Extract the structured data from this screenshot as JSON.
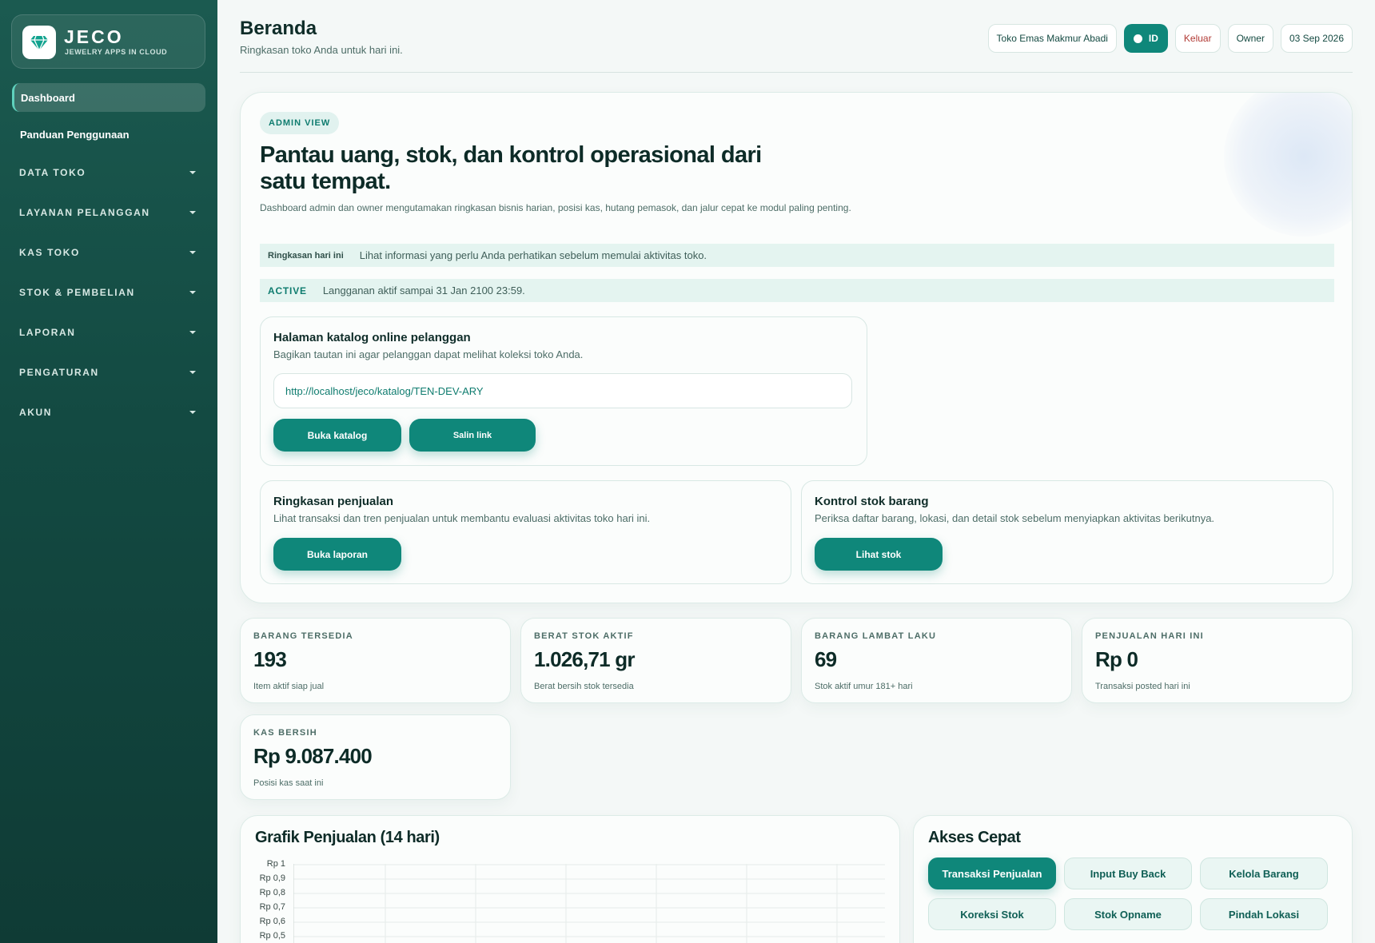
{
  "brand": {
    "name": "JECO",
    "tagline": "JEWELRY APPS IN CLOUD"
  },
  "sidebar": {
    "items": [
      {
        "label": "Dashboard",
        "active": true
      },
      {
        "label": "Panduan Penggunaan"
      }
    ],
    "groups": [
      {
        "label": "DATA TOKO"
      },
      {
        "label": "LAYANAN PELANGGAN"
      },
      {
        "label": "KAS TOKO"
      },
      {
        "label": "STOK & PEMBELIAN"
      },
      {
        "label": "LAPORAN"
      },
      {
        "label": "PENGATURAN"
      },
      {
        "label": "AKUN"
      }
    ]
  },
  "header": {
    "title": "Beranda",
    "subtitle": "Ringkasan toko Anda untuk hari ini.",
    "store": "Toko Emas Makmur Abadi",
    "lang": "ID",
    "logout": "Keluar",
    "role": "Owner",
    "date": "03 Sep 2026"
  },
  "hero": {
    "badge": "ADMIN VIEW",
    "title": "Pantau uang, stok, dan kontrol operasional dari satu tempat.",
    "desc": "Dashboard admin dan owner mengutamakan ringkasan bisnis harian, posisi kas, hutang pemasok, dan jalur cepat ke modul paling penting.",
    "summary_label": "Ringkasan hari ini",
    "summary_text": "Lihat informasi yang perlu Anda perhatikan sebelum memulai aktivitas toko.",
    "status": "ACTIVE",
    "status_text": "Langganan aktif sampai 31 Jan 2100 23:59."
  },
  "catalog": {
    "title": "Halaman katalog online pelanggan",
    "subtitle": "Bagikan tautan ini agar pelanggan dapat melihat koleksi toko Anda.",
    "url": "http://localhost/jeco/katalog/TEN-DEV-ARY",
    "open_label": "Buka katalog",
    "copy_label": "Salin link"
  },
  "sales_summary": {
    "title": "Ringkasan penjualan",
    "subtitle": "Lihat transaksi dan tren penjualan untuk membantu evaluasi aktivitas toko hari ini.",
    "button": "Buka laporan"
  },
  "stock_control": {
    "title": "Kontrol stok barang",
    "subtitle": "Periksa daftar barang, lokasi, dan detail stok sebelum menyiapkan aktivitas berikutnya.",
    "button": "Lihat stok"
  },
  "stats": [
    {
      "label": "BARANG TERSEDIA",
      "value": "193",
      "note": "Item aktif siap jual"
    },
    {
      "label": "BERAT STOK AKTIF",
      "value": "1.026,71 gr",
      "note": "Berat bersih stok tersedia"
    },
    {
      "label": "BARANG LAMBAT LAKU",
      "value": "69",
      "note": "Stok aktif umur 181+ hari"
    },
    {
      "label": "PENJUALAN HARI INI",
      "value": "Rp 0",
      "note": "Transaksi posted hari ini"
    },
    {
      "label": "KAS BERSIH",
      "value": "Rp 9.087.400",
      "note": "Posisi kas saat ini"
    }
  ],
  "chart_data": {
    "type": "line",
    "title": "Grafik Penjualan (14 hari)",
    "yticks": [
      "Rp 1",
      "Rp 0,9",
      "Rp 0,8",
      "Rp 0,7",
      "Rp 0,6",
      "Rp 0,5"
    ],
    "ylim": [
      0,
      1
    ],
    "grid": true
  },
  "quick_access": {
    "title": "Akses Cepat",
    "buttons": [
      {
        "label": "Transaksi Penjualan",
        "primary": true
      },
      {
        "label": "Input Buy Back"
      },
      {
        "label": "Kelola Barang"
      },
      {
        "label": "Koreksi Stok"
      },
      {
        "label": "Stok Opname"
      },
      {
        "label": "Pindah Lokasi"
      }
    ]
  },
  "colors": {
    "accent": "#0f877a",
    "sidebar": "#134a42",
    "danger": "#b13a35"
  }
}
